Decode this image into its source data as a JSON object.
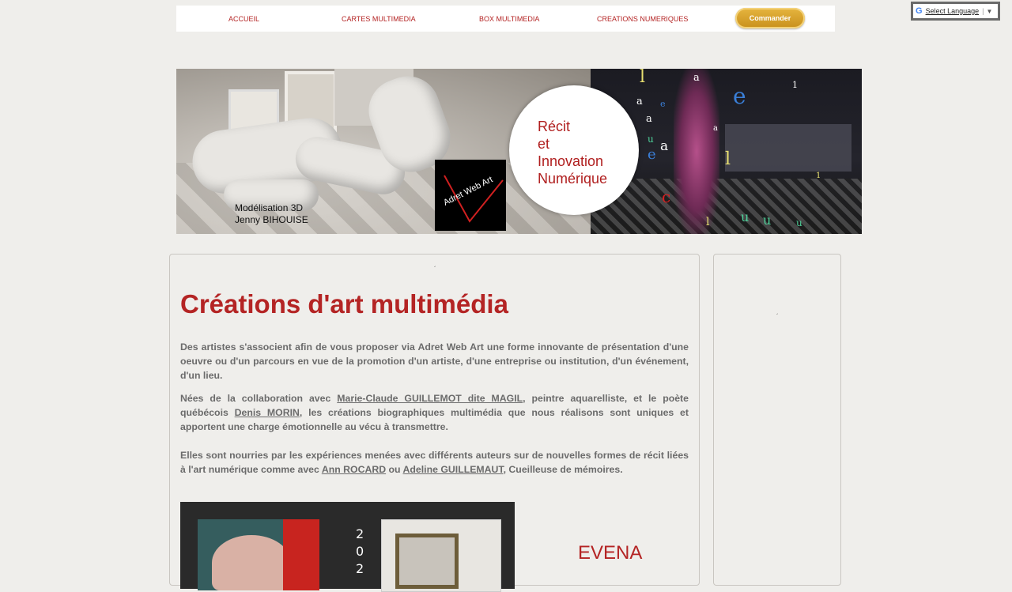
{
  "nav": {
    "items": [
      "ACCUEIL",
      "CARTES MULTIMEDIA",
      "BOX MULTIMEDIA",
      "CREATIONS NUMERIQUES"
    ],
    "order_button": "Commander"
  },
  "translate": {
    "label": "Select Language",
    "g": "G",
    "arrow": "▼"
  },
  "banner": {
    "credit_line1": "Modélisation 3D",
    "credit_line2": "Jenny BIHOUISE",
    "logo_text": "Adret Web Art",
    "circle_lines": [
      "Récit",
      "et",
      "Innovation",
      "Numérique"
    ],
    "letters": [
      "l",
      "a",
      "a",
      "a",
      "e",
      "e",
      "u",
      "a",
      "e",
      "l",
      "u",
      "u",
      "u",
      "c",
      "l",
      "1",
      "1",
      "a"
    ]
  },
  "main": {
    "title": "Créations d'art multimédia",
    "p1": "Des artistes s'associent afin de vous proposer via Adret Web Art une forme innovante de présentation d'une oeuvre ou d'un parcours en vue de la promotion d'un artiste, d'une entreprise ou institution, d'un événement, d'un lieu.",
    "p2_a": "Nées de la collaboration avec ",
    "p2_link1": "Marie-Claude GUILLEMOT dite MAGIL",
    "p2_b": ", peintre aquarelliste, et le poète québécois ",
    "p2_link2": "Denis MORIN",
    "p2_c": ", les créations biographiques multimédia que nous réalisons sont uniques et apportent une charge émotionnelle au vécu à transmettre.",
    "p3_a": "Elles sont nourries par les expériences menées avec différents auteurs sur de nouvelles formes de récit liées à l'art numérique comme avec ",
    "p3_link1": "Ann ROCARD",
    "p3_b": " ou ",
    "p3_link2": "Adeline GUILLEMAUT",
    "p3_c": ", Cueilleuse de mémoires.",
    "thumb_year": [
      "2",
      "0",
      "2"
    ],
    "evena": "EVENA",
    "tick": "´"
  },
  "side": {
    "tick": "´"
  },
  "colors": {
    "accent": "#b42424",
    "text": "#6b6b6b",
    "background": "#efeeeb",
    "button": "#d9a531"
  }
}
